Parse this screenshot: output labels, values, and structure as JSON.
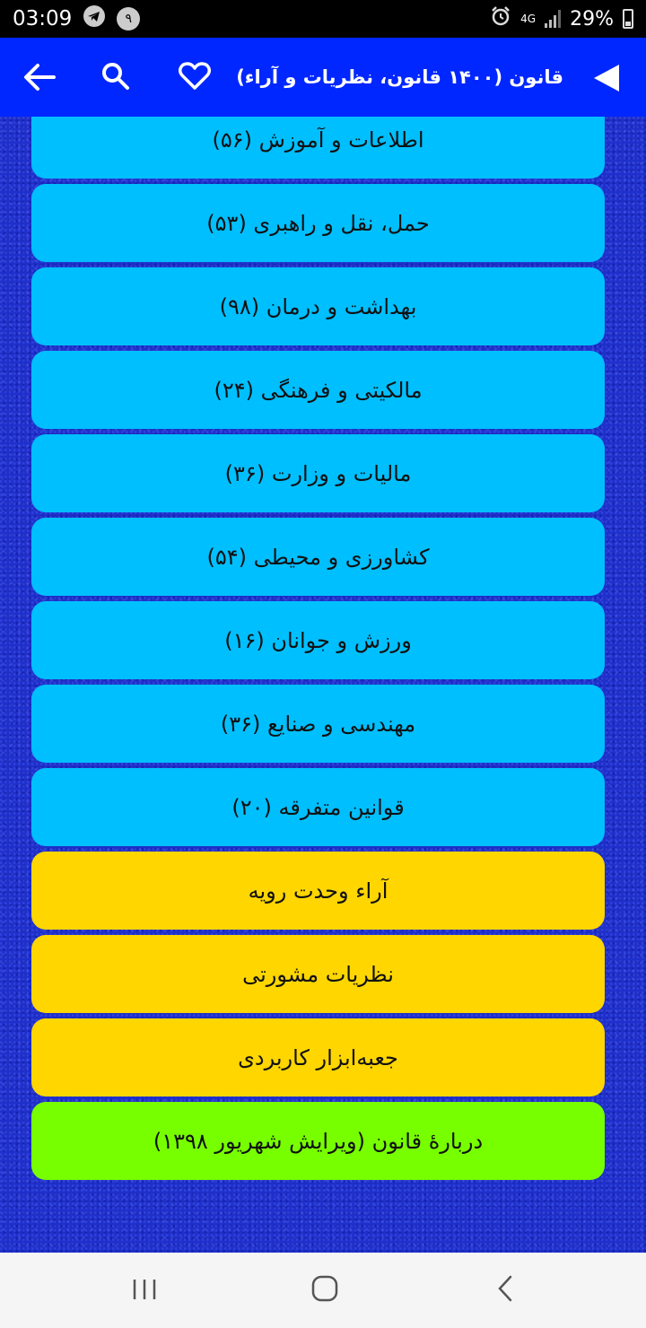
{
  "status_bar": {
    "time": "03:09",
    "notification_badge": "۹",
    "network": "4G",
    "battery": "29%"
  },
  "app_bar": {
    "title": "قانون (۱۴۰۰ قانون، نظریات و آراء)"
  },
  "menu": {
    "items": [
      {
        "label": "اطلاعات و آموزش (۵۶)",
        "color": "#00bfff"
      },
      {
        "label": "حمل، نقل و راهبری (۵۳)",
        "color": "#00bfff"
      },
      {
        "label": "بهداشت و درمان (۹۸)",
        "color": "#00bfff"
      },
      {
        "label": "مالکیتی و فرهنگی (۲۴)",
        "color": "#00bfff"
      },
      {
        "label": "مالیات و وزارت (۳۶)",
        "color": "#00bfff"
      },
      {
        "label": "کشاورزی و محیطی (۵۴)",
        "color": "#00bfff"
      },
      {
        "label": "ورزش و جوانان (۱۶)",
        "color": "#00bfff"
      },
      {
        "label": "مهندسی و صنایع (۳۶)",
        "color": "#00bfff"
      },
      {
        "label": "قوانین متفرقه (۲۰)",
        "color": "#00bfff"
      },
      {
        "label": "آراء وحدت رویه",
        "color": "#ffd600"
      },
      {
        "label": "نظریات مشورتی",
        "color": "#ffd600"
      },
      {
        "label": "جعبه‌ابزار کاربردی",
        "color": "#ffd600"
      },
      {
        "label": "دربارهٔ قانون (ویرایش شهریور ۱۳۹۸)",
        "color": "#77ff00"
      }
    ]
  },
  "icons": {
    "back": "arrow-left-icon",
    "search": "search-icon",
    "favorite": "heart-icon",
    "play": "play-icon",
    "recents": "recents-icon",
    "home": "home-icon",
    "nav_back": "chevron-left-icon"
  },
  "colors": {
    "app_bar": "#0027ff",
    "background": "#1f2fc9",
    "category": "#00bfff",
    "special": "#ffd600",
    "about": "#77ff00"
  }
}
